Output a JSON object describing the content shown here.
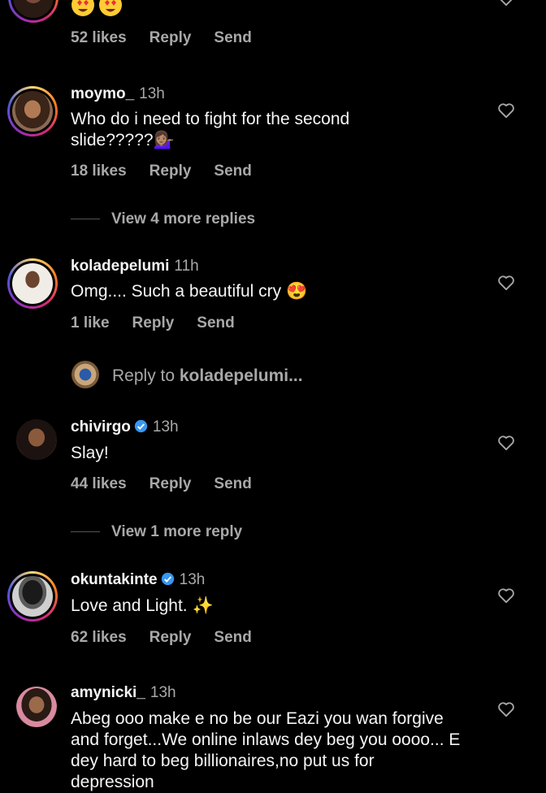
{
  "colors": {
    "background": "#000000",
    "text": "#f5f5f5",
    "muted": "#a8a8a8",
    "verified": "#3897f0"
  },
  "top_comment": {
    "likes": "52 likes",
    "reply": "Reply",
    "send": "Send"
  },
  "comments": [
    {
      "username": "moymo_",
      "time": "13h",
      "text": "Who do i need to fight for the second slide?????💁🏽‍♀️",
      "likes": "18 likes",
      "reply": "Reply",
      "send": "Send",
      "view_more": "View 4 more replies"
    },
    {
      "username": "koladepelumi",
      "time": "11h",
      "text": "Omg.... Such a beautiful cry 😍",
      "likes": "1 like",
      "reply": "Reply",
      "send": "Send",
      "reply_prompt": "Reply to ",
      "reply_target": "koladepelumi..."
    },
    {
      "username": "chivirgo",
      "time": "13h",
      "verified": true,
      "text": "Slay!",
      "likes": "44 likes",
      "reply": "Reply",
      "send": "Send",
      "view_more": "View 1 more reply"
    },
    {
      "username": "okuntakinte",
      "time": "13h",
      "verified": true,
      "text": "Love and Light. ✨",
      "likes": "62 likes",
      "reply": "Reply",
      "send": "Send"
    },
    {
      "username": "amynicki_",
      "time": "13h",
      "text": "Abeg ooo make e no be our Eazi you wan forgive and forget...We online inlaws dey beg you oooo... E dey hard to beg billionaires,no put us for depression"
    }
  ],
  "icons": {
    "like": "heart-outline-icon",
    "verified": "verified-badge-icon",
    "heart_eyes": "heart-eyes-emoji"
  }
}
